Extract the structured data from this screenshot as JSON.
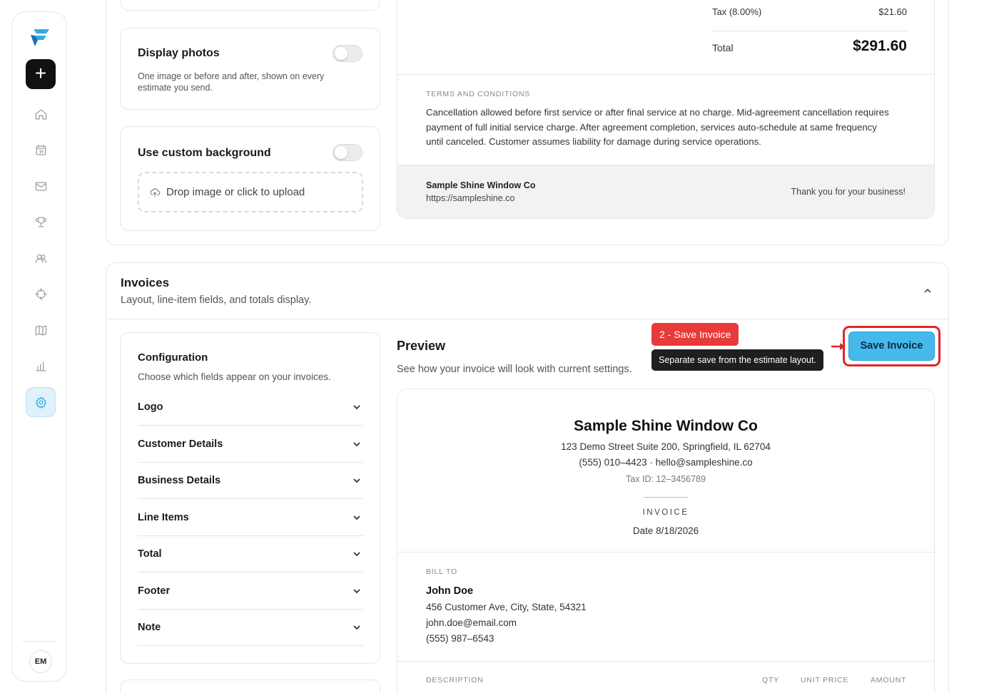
{
  "sidebar": {
    "new_label": "+",
    "avatar_initials": "EM",
    "accent_color": "#36a9e1"
  },
  "display_photos": {
    "title": "Display photos",
    "description": "One image or before and after, shown on every estimate you send.",
    "enabled": false
  },
  "custom_background": {
    "title": "Use custom background",
    "enabled": false,
    "dropzone_label": "Drop image or click to upload"
  },
  "estimate_preview": {
    "tax_label": "Tax (8.00%)",
    "tax_value": "$21.60",
    "total_label": "Total",
    "total_value": "$291.60",
    "terms_label": "TERMS AND CONDITIONS",
    "terms_text": "Cancellation allowed before first service or after final service at no charge. Mid-agreement cancellation requires payment of full initial service charge. After agreement completion, services auto-schedule at same frequency until canceled. Customer assumes liability for damage during service operations.",
    "footer_company": "Sample Shine Window Co",
    "footer_url": "https://sampleshine.co",
    "footer_thanks": "Thank you for your business!"
  },
  "invoices": {
    "title": "Invoices",
    "subtitle": "Layout, line-item fields, and totals display.",
    "configuration": {
      "title": "Configuration",
      "subtitle": "Choose which fields appear on your invoices.",
      "items": [
        "Logo",
        "Customer Details",
        "Business Details",
        "Line Items",
        "Total",
        "Footer",
        "Note"
      ]
    },
    "preview_title": "Preview",
    "preview_subtitle": "See how your invoice will look with current settings.",
    "save_label": "Save Invoice",
    "annotation": {
      "badge": "2 - Save Invoice",
      "tooltip": "Separate save from the estimate layout.",
      "color": "#e83a3a"
    },
    "invoice_preview": {
      "company": "Sample Shine Window Co",
      "address": "123 Demo Street Suite 200, Springfield, IL 62704",
      "contact": "(555) 010–4423 · hello@sampleshine.co",
      "tax_id": "Tax ID: 12–3456789",
      "doc_label": "INVOICE",
      "date": "Date 8/18/2026",
      "bill_to_label": "BILL TO",
      "customer_name": "John Doe",
      "customer_address": "456 Customer Ave, City, State, 54321",
      "customer_email": "john.doe@email.com",
      "customer_phone": "(555) 987–6543",
      "columns": [
        "DESCRIPTION",
        "QTY",
        "UNIT PRICE",
        "AMOUNT"
      ]
    }
  }
}
